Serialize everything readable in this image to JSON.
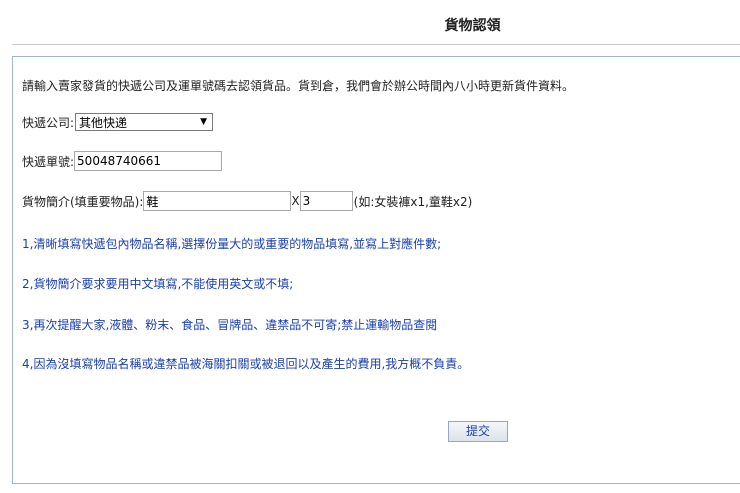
{
  "page": {
    "title": "貨物認領",
    "intro": "請輸入賣家發貨的快遞公司及運單號碼去認領貨品。貨到倉，我們會於辦公時間內八小時更新貨件資料。"
  },
  "form": {
    "courier_label": "快遞公司:",
    "courier_value": "其他快递",
    "tracking_label": "快遞單號:",
    "tracking_value": "50048740661",
    "goods_label": "貨物簡介(填重要物品):",
    "goods_value": "鞋",
    "times_sign": "X",
    "quantity_value": "3",
    "goods_hint": "(如:女裝褲x1,童鞋x2)"
  },
  "notes": [
    "1,清晰填寫快遞包內物品名稱,選擇份量大的或重要的物品填寫,並寫上對應件數;",
    "2,貨物簡介要求要用中文填寫,不能使用英文或不填;",
    "3,再次提醒大家,液體、粉末、食品、冒牌品、違禁品不可寄;禁止運輸物品查閱",
    "4,因為沒填寫物品名稱或違禁品被海關扣關或被退回以及產生的費用,我方概不負責。"
  ],
  "actions": {
    "submit_label": "提交"
  },
  "icons": {
    "select_arrow": "dropdown-arrow-icon"
  }
}
